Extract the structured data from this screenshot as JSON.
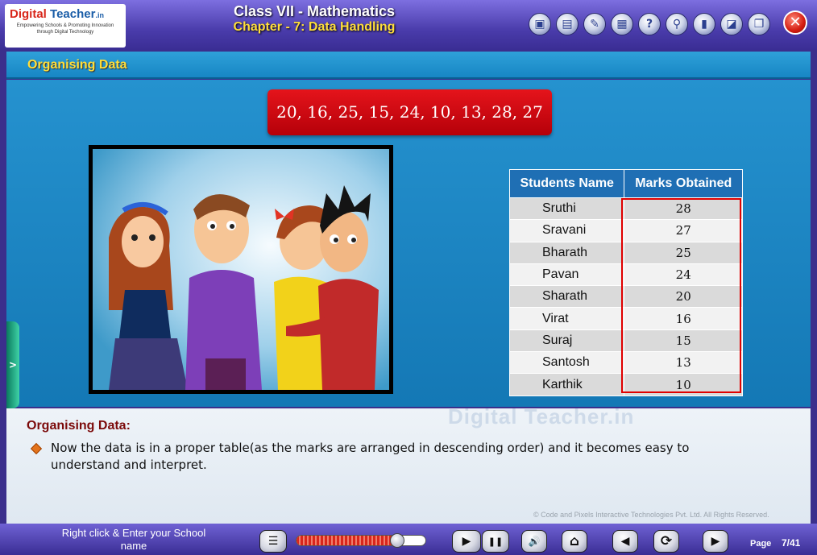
{
  "header": {
    "logo": {
      "brand": "Digital",
      "brand_suffix": "Teacher",
      "domain": ".in",
      "tagline": "Empowering Schools & Promoting Innovation through Digital Technology"
    },
    "class_title": "Class VII - Mathematics",
    "chapter_title": "Chapter - 7: Data Handling",
    "tools": [
      {
        "icon": "home-folder-icon",
        "glyph": "▣"
      },
      {
        "icon": "book-icon",
        "glyph": "▤"
      },
      {
        "icon": "pencil-icon",
        "glyph": "✎"
      },
      {
        "icon": "notes-icon",
        "glyph": "▦"
      },
      {
        "icon": "help-icon",
        "glyph": "?"
      },
      {
        "icon": "search-icon",
        "glyph": "⚲"
      },
      {
        "icon": "bookmark-icon",
        "glyph": "▮"
      },
      {
        "icon": "eraser-icon",
        "glyph": "◪"
      },
      {
        "icon": "window-icon",
        "glyph": "❐"
      }
    ],
    "close_glyph": "✕"
  },
  "section_title": "Organising Data",
  "data_sequence": "20, 16, 25, 15, 24, 10, 13, 28, 27",
  "side_tab_glyph": ">",
  "table": {
    "headers": [
      "Students Name",
      "Marks Obtained"
    ],
    "rows": [
      {
        "name": "Sruthi",
        "marks": "28"
      },
      {
        "name": "Sravani",
        "marks": "27"
      },
      {
        "name": "Bharath",
        "marks": "25"
      },
      {
        "name": "Pavan",
        "marks": "24"
      },
      {
        "name": "Sharath",
        "marks": "20"
      },
      {
        "name": "Virat",
        "marks": "16"
      },
      {
        "name": "Suraj",
        "marks": "15"
      },
      {
        "name": "Santosh",
        "marks": "13"
      },
      {
        "name": "Karthik",
        "marks": "10"
      }
    ]
  },
  "panel": {
    "heading": "Organising Data:",
    "text": "Now the data is in a proper table(as the marks are arranged in descending order) and it becomes easy to understand and interpret.",
    "watermark": "Digital Teacher.in",
    "copyright": "© Code and Pixels Interactive Technologies  Pvt. Ltd. All Rights Reserved."
  },
  "footer": {
    "school_prompt": "Right click & Enter your School name",
    "progress_fraction": 0.78,
    "page_label": "Page",
    "page_number": "7/41",
    "controls": {
      "menu": "☰",
      "play": "▶",
      "pause": "❚❚",
      "volume": "🔊",
      "home": "⌂",
      "prev": "◀",
      "replay": "⟳",
      "next": "▶"
    }
  }
}
